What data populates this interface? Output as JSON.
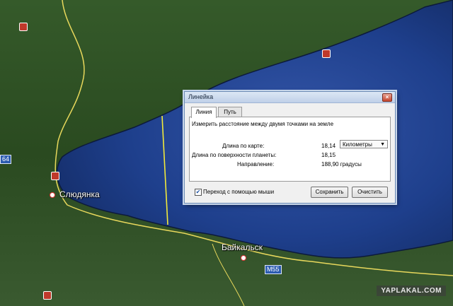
{
  "map": {
    "places": {
      "slyudyanka": "Слюдянка",
      "baikalsk": "Байкальск"
    },
    "road_badges": {
      "m55": "M55",
      "r64": "64"
    },
    "watermark": "YAPLAKAL.COM"
  },
  "dialog": {
    "title": "Линейка",
    "close_glyph": "×",
    "tabs": {
      "line": "Линия",
      "path": "Путь"
    },
    "description": "Измерить расстояние между двумя точками на земле",
    "map_length_label": "Длина по карте:",
    "map_length_value": "18,14",
    "units_selected": "Километры",
    "surface_length_label": "Длина по поверхности планеты:",
    "surface_length_value": "18,15",
    "direction_label": "Направление:",
    "direction_value": "188,90 градусы",
    "mouse_nav_label": "Переход с помощью мыши",
    "mouse_nav_checked": true,
    "save_label": "Сохранить",
    "clear_label": "Очистить"
  },
  "colors": {
    "water": "#1d3f8a",
    "land": "#2e5226",
    "measure_line": "#f2ea3a",
    "road": "#e8d85c"
  }
}
